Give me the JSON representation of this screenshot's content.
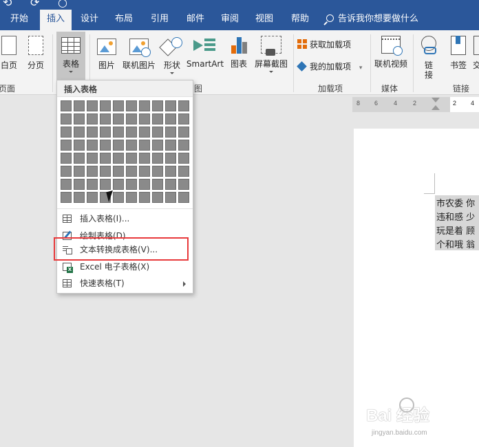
{
  "tabs": [
    {
      "label": "开始"
    },
    {
      "label": "插入"
    },
    {
      "label": "设计"
    },
    {
      "label": "布局"
    },
    {
      "label": "引用"
    },
    {
      "label": "邮件"
    },
    {
      "label": "审阅"
    },
    {
      "label": "视图"
    },
    {
      "label": "帮助"
    }
  ],
  "active_tab": "插入",
  "tell_me": "告诉我你想要做什么",
  "ribbon": {
    "blank_page": "白页",
    "page_break": "分页",
    "pages_group": "页面",
    "table": "表格",
    "picture": "图片",
    "online_picture": "联机图片",
    "shapes": "形状",
    "smartart": "SmartArt",
    "chart": "图表",
    "screenshot": "屏幕截图",
    "illustrations_group_tail": "图",
    "get_addins": "获取加载项",
    "my_addins": "我的加载项",
    "addins_group": "加载项",
    "online_video": "联机视频",
    "media_group": "媒体",
    "link": "链接",
    "bookmark": "书签",
    "crossref_partial": "交",
    "links_group": "链接"
  },
  "table_menu": {
    "header": "插入表格",
    "grid_cols": 10,
    "grid_rows": 8,
    "items": [
      {
        "label": "插入表格(I)...",
        "icon": "table-icon"
      },
      {
        "label": "绘制表格(D)",
        "icon": "draw-table-icon"
      },
      {
        "label": "文本转换成表格(V)...",
        "icon": "text-to-table-icon"
      },
      {
        "label": "Excel 电子表格(X)",
        "icon": "excel-icon"
      },
      {
        "label": "快速表格(T)",
        "icon": "quick-table-icon"
      }
    ]
  },
  "ruler": {
    "ticks": [
      "8",
      "6",
      "4",
      "2",
      "2",
      "4"
    ]
  },
  "document": {
    "lines": [
      "市农委  你",
      "违和感  少",
      "玩是着  顾",
      "个和哦  翁"
    ]
  },
  "watermark": {
    "main": "Bai 经验",
    "sub": "jingyan.baidu.com"
  },
  "colors": {
    "ribbon_blue": "#2b579a",
    "highlight": "#e8393b"
  }
}
